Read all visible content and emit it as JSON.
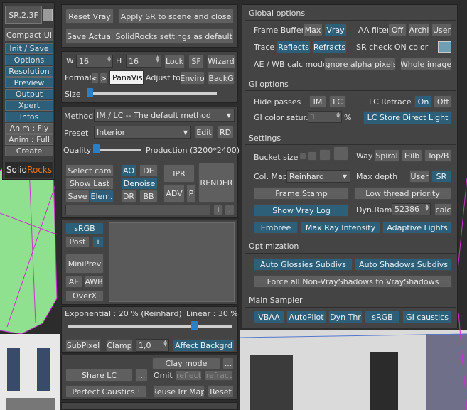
{
  "logo": "SR.2.3F",
  "left_menu": {
    "compact": "Compact UI",
    "items": [
      "Init / Save",
      "Options",
      "Resolution",
      "Preview",
      "Output",
      "Xpert",
      "Infos",
      "Anim : Fly",
      "Anim : Full",
      "Create"
    ],
    "brand_solid": "Solid",
    "brand_rocks": "Rocks"
  },
  "top": {
    "reset": "Reset Vray",
    "apply": "Apply SR to scene and close",
    "save_settings": ">> Save Actual SolidRocks settings as default <<"
  },
  "res": {
    "w_label": "W",
    "w": "16",
    "h_label": "H",
    "h": "16",
    "lock": "Lock",
    "sf": "SF",
    "wizard": "Wizard",
    "format_label": "Format",
    "prev": "<",
    "next": ">",
    "format_value": "PanaVis",
    "adjust": "Adjust to",
    "enviro": "Enviro",
    "backg": "BackG",
    "size_label": "Size"
  },
  "method": {
    "label": "Method",
    "value": "IM / LC -- The default method",
    "preset_label": "Preset",
    "preset_value": "Interior",
    "edit": "Edit",
    "rd": "RD",
    "quality_label": "Quality",
    "quality_value": "Production (3200*2400)"
  },
  "render": {
    "select_cam": "Select cam",
    "ao": "AO",
    "de": "DE",
    "ipr": "IPR",
    "show_last": "Show Last",
    "denoise": "Denoise",
    "render": "RENDER",
    "save": "Save",
    "elem": "Elem.",
    "dr": "DR",
    "bb": "BB",
    "adv": "ADV",
    "p": "P",
    "plus": "+",
    "more": "..."
  },
  "vfb": {
    "srgb": "sRGB",
    "post": "Post",
    "i": "i",
    "miniprev": "MiniPrev",
    "ae": "AE",
    "awb": "AWB",
    "overx": "OverX"
  },
  "exposure": {
    "exp": "Exponential : 20 % (Reinhard)",
    "linear": "Linear : 30 %",
    "subpixel": "SubPixel",
    "clamp": "Clamp",
    "clamp_value": "1,0",
    "affect": "Affect Backgrd"
  },
  "bottom": {
    "clay": "Clay mode",
    "share_lc": "Share LC",
    "dots": "...",
    "omit": "Omit :",
    "reflect": "reflect",
    "refract": "refract",
    "caustics": "Perfect Caustics !",
    "reuse": "Reuse Irr Map",
    "reset": "Reset"
  },
  "options": {
    "global_hdr": "Global options",
    "frame_buffer": "Frame Buffer",
    "max": "Max",
    "vray": "Vray",
    "aa_filter": "AA filter",
    "off": "Off",
    "archi": "Archi",
    "user": "User",
    "trace": "Trace",
    "reflects": "Reflects",
    "refracts": "Refracts",
    "sr_check": "SR check ON color",
    "ae_wb": "AE / WB calc mode",
    "ignore_alpha": "Ignore alpha pixels",
    "whole_image": "Whole image",
    "gi_hdr": "GI options",
    "hide_passes": "Hide passes",
    "im": "IM",
    "lc": "LC",
    "lc_retrace": "LC Retrace",
    "on": "On",
    "off2": "Off",
    "gi_satur": "GI color satur.",
    "gi_satur_value": "1",
    "percent": "%",
    "lc_store": "LC Store Direct Light",
    "settings_hdr": "Settings",
    "bucket": "Bucket size",
    "way": "Way",
    "spiral": "Spiral",
    "hilb": "Hilb",
    "topb": "Top/B",
    "colmap": "Col. Map",
    "colmap_value": "Reinhard",
    "maxdepth": "Max depth",
    "user2": "User",
    "sr": "SR",
    "frame_stamp": "Frame Stamp",
    "low_thread": "Low thread priority",
    "show_log": "Show Vray Log",
    "dynram": "Dyn.Ram",
    "dynram_value": "52386",
    "calc": "calc",
    "embree": "Embree",
    "max_ray": "Max Ray Intensity",
    "adaptive": "Adaptive Lights",
    "opt_hdr": "Optimization",
    "auto_gloss": "Auto Glossies Subdivs",
    "auto_shadow": "Auto Shadows Subdivs",
    "force": "Force all Non-VrayShadows to VrayShadows",
    "sampler_hdr": "Main Sampler",
    "vbaa": "VBAA",
    "autopilot": "AutoPilot",
    "dynthr": "Dyn Thr",
    "srgb": "sRGB",
    "gicaustics": "GI caustics"
  },
  "colors": {
    "accent": "#2d5f78",
    "knob": "#2b7fc6",
    "panel": "#444444",
    "swatch": "#6f9fb4"
  }
}
